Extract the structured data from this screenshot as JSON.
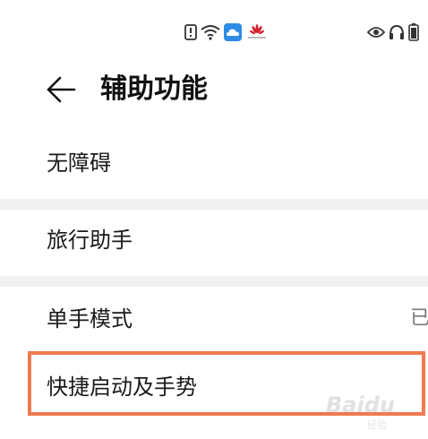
{
  "header": {
    "title": "辅助功能",
    "back_icon": "arrow-left-icon"
  },
  "status_bar": {
    "center_icons": [
      "alert-icon",
      "wifi-icon",
      "cloud-icon",
      "huawei-logo-icon"
    ],
    "right_icons": [
      "eye-icon",
      "headphones-icon",
      "battery-icon"
    ]
  },
  "settings": {
    "items": [
      {
        "label": "无障碍"
      },
      {
        "label": "旅行助手"
      },
      {
        "label": "单手模式",
        "value": "已"
      },
      {
        "label": "快捷启动及手势"
      }
    ]
  },
  "watermark": {
    "text": "Baidu",
    "sub": "经验"
  },
  "colors": {
    "highlight": "#ee7a4f",
    "divider": "#f1f1f1",
    "cloud_blue": "#2f8be6",
    "huawei_red": "#d3202f"
  }
}
